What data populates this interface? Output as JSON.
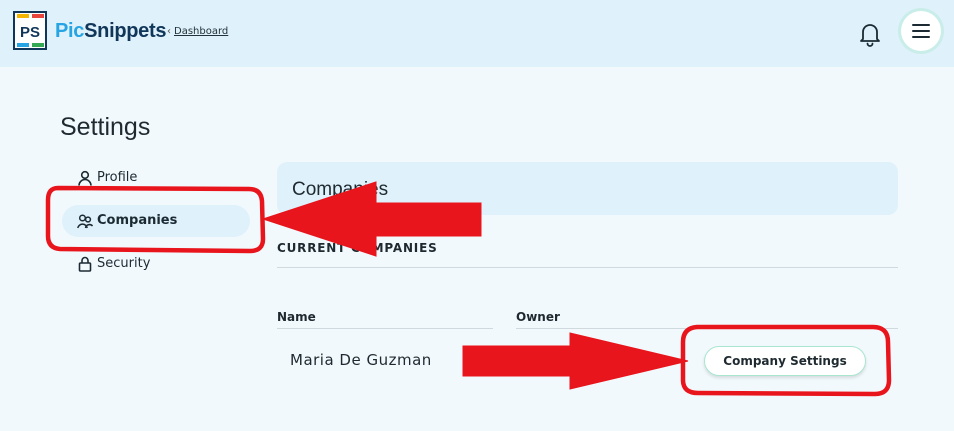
{
  "header": {
    "brand_pic": "Pic",
    "brand_snippets": "Snippets",
    "logo_text": "PS",
    "breadcrumb": "Dashboard",
    "bell_icon": "bell-icon",
    "menu_icon": "hamburger-menu-icon"
  },
  "settings": {
    "title": "Settings",
    "nav": [
      {
        "label": "Profile",
        "icon": "user-icon",
        "active": false
      },
      {
        "label": "Companies",
        "icon": "users-icon",
        "active": true
      },
      {
        "label": "Security",
        "icon": "lock-icon",
        "active": false
      }
    ]
  },
  "main": {
    "panel_title": "Companies",
    "section_label": "CURRENT COMPANIES",
    "columns": [
      "Name",
      "Owner"
    ],
    "rows": [
      {
        "name": "Maria De Guzman",
        "action": "Company Settings"
      }
    ]
  },
  "annotation": {
    "color": "#e8151c"
  }
}
